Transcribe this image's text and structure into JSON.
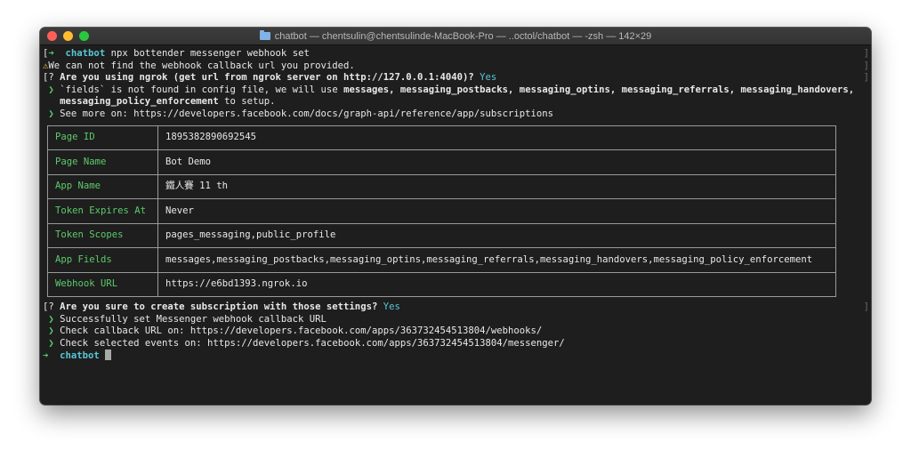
{
  "window": {
    "title": "chatbot — chentsulin@chentsulinde-MacBook-Pro — ..octol/chatbot — -zsh — 142×29"
  },
  "terminal": {
    "prompt_dir": "chatbot",
    "command": "npx bottender messenger webhook set",
    "warning": "We can not find the webhook callback url you provided.",
    "q1_mark": "[?",
    "question1": "Are you using ngrok (get url from ngrok server on http://127.0.0.1:4040)?",
    "answer1": "Yes",
    "fields_text": "`fields` is not found in config file, we will use",
    "fields_list": "messages, messaging_postbacks, messaging_optins, messaging_referrals, messaging_handovers,",
    "fields_list2": "messaging_policy_enforcement",
    "fields_tail": "to setup.",
    "see_more": "See more on: https://developers.facebook.com/docs/graph-api/reference/app/subscriptions",
    "table": [
      {
        "key": "Page ID",
        "value": "1895382890692545"
      },
      {
        "key": "Page Name",
        "value": "Bot Demo"
      },
      {
        "key": "App Name",
        "value": "鐵人賽 11 th"
      },
      {
        "key": "Token Expires At",
        "value": "Never"
      },
      {
        "key": "Token Scopes",
        "value": "pages_messaging,public_profile"
      },
      {
        "key": "App Fields",
        "value": "messages,messaging_postbacks,messaging_optins,messaging_referrals,messaging_handovers,messaging_policy_enforcement"
      },
      {
        "key": "Webhook URL",
        "value": "https://e6bd1393.ngrok.io"
      }
    ],
    "question2": "Are you sure to create subscription with those settings?",
    "answer2": "Yes",
    "success": "Successfully set Messenger webhook callback URL",
    "check_callback": "Check callback URL on: https://developers.facebook.com/apps/363732454513804/webhooks/",
    "check_events": "Check selected events on: https://developers.facebook.com/apps/363732454513804/messenger/",
    "final_prompt_dir": "chatbot",
    "arrow_glyph": "➜",
    "chevron_glyph": "❯",
    "warn_glyph": "⚠",
    "edge_glyph": "]",
    "bracket_glyph": "["
  }
}
